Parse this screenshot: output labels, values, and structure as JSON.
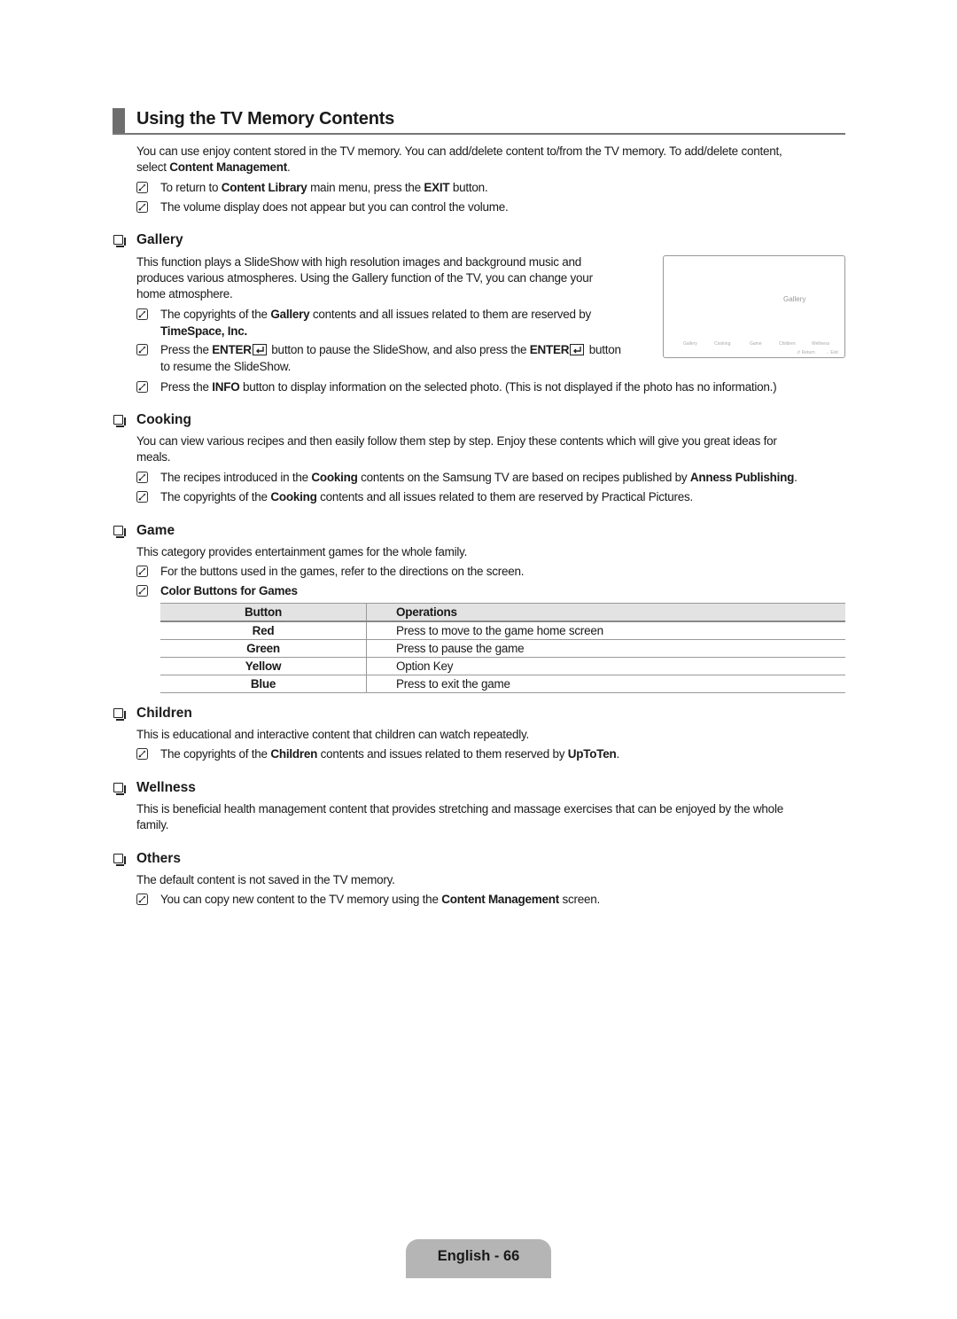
{
  "page_title": "Using the TV Memory Contents",
  "intro": {
    "line1": "You can use enjoy content stored in the TV memory. You can add/delete content to/from the TV memory. To add/delete content,",
    "line2_pre": "select ",
    "line2_bold": "Content Management",
    "line2_post": ".",
    "notes": [
      {
        "pre": "To return to ",
        "b1": "Content Library",
        "mid": " main menu, press the ",
        "b2": "EXIT",
        "post": " button."
      },
      {
        "text": "The volume display does not appear but you can control the volume."
      }
    ]
  },
  "sections": {
    "gallery": {
      "heading": "Gallery",
      "body": [
        "This function plays a SlideShow with high resolution images and background music and",
        "produces various atmospheres. Using the Gallery function of the TV, you can change your",
        "home atmosphere."
      ],
      "note1": {
        "pre": "The copyrights of the ",
        "b1": "Gallery",
        "post": " contents and all issues related to them are reserved by",
        "line2_bold": "TimeSpace, Inc."
      },
      "note2": {
        "pre": "Press the ",
        "b1": "ENTER",
        "mid": " button to pause the SlideShow, and also press the ",
        "b2": "ENTER",
        "post": " button",
        "line2": "to resume the SlideShow."
      },
      "note3": {
        "pre": "Press the ",
        "b1": "INFO",
        "post": " button to display information on the selected photo. (This is not displayed if the photo has no information.)"
      },
      "screen": {
        "title": "Gallery",
        "menu": [
          "Gallery",
          "Cooking",
          "Game",
          "Children",
          "Wellness"
        ],
        "return_label": "Return",
        "exit_label": "Exit"
      }
    },
    "cooking": {
      "heading": "Cooking",
      "body": [
        "You can view various recipes and then easily follow them step by step. Enjoy these contents which will give you great ideas for",
        "meals."
      ],
      "note1": {
        "pre": "The recipes introduced in the ",
        "b1": "Cooking",
        "mid": " contents on the Samsung TV are based on recipes published by ",
        "b2": "Anness Publishing",
        "post": "."
      },
      "note2": {
        "pre": "The copyrights of the ",
        "b1": "Cooking",
        "post": " contents and all issues related to them are reserved by Practical Pictures."
      }
    },
    "game": {
      "heading": "Game",
      "body": "This category provides entertainment games for the whole family.",
      "note1": "For the buttons used in the games, refer to the directions on the screen.",
      "note2_bold": "Color Buttons for Games",
      "table": {
        "headers": [
          "Button",
          "Operations"
        ],
        "rows": [
          [
            "Red",
            "Press to move to the game home screen"
          ],
          [
            "Green",
            "Press to pause the game"
          ],
          [
            "Yellow",
            "Option Key"
          ],
          [
            "Blue",
            "Press to exit the game"
          ]
        ]
      }
    },
    "children": {
      "heading": "Children",
      "body": "This is educational and interactive content that children can watch repeatedly.",
      "note1": {
        "pre": "The copyrights of the ",
        "b1": "Children",
        "mid": " contents and issues related to them reserved by ",
        "b2": "UpToTen",
        "post": "."
      }
    },
    "wellness": {
      "heading": "Wellness",
      "body": [
        "This is beneficial health management content that provides stretching and massage exercises that can be enjoyed by the whole",
        "family."
      ]
    },
    "others": {
      "heading": "Others",
      "body": "The default content is not saved in the TV memory.",
      "note1": {
        "pre": "You can copy new content to the TV memory using the ",
        "b1": "Content Management",
        "post": " screen."
      }
    }
  },
  "footer": {
    "label": "English - 66"
  }
}
